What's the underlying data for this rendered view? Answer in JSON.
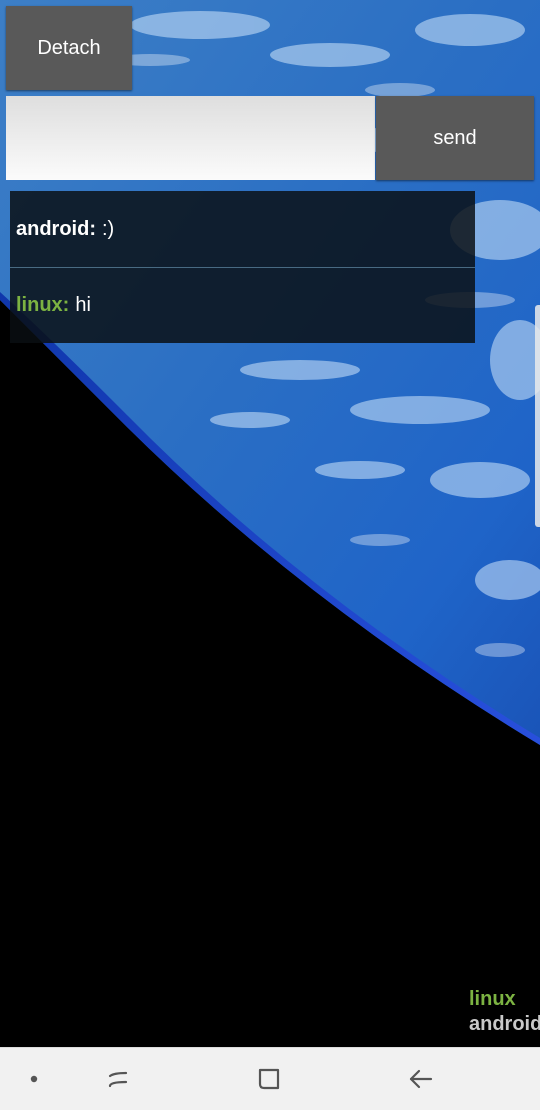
{
  "toolbar": {
    "detach_label": "Detach",
    "send_label": "send"
  },
  "input": {
    "value": "",
    "placeholder": ""
  },
  "messages": [
    {
      "sender": "android:",
      "text": ":)"
    },
    {
      "sender": "linux:",
      "text": "hi"
    }
  ],
  "users": [
    "linux",
    "android"
  ],
  "colors": {
    "button_bg": "#595959",
    "accent_green": "#7cb342",
    "navbar_bg": "#f1f1f1"
  },
  "navigation": {
    "icons": [
      "dot-icon",
      "recents-icon",
      "home-icon",
      "back-icon"
    ]
  }
}
